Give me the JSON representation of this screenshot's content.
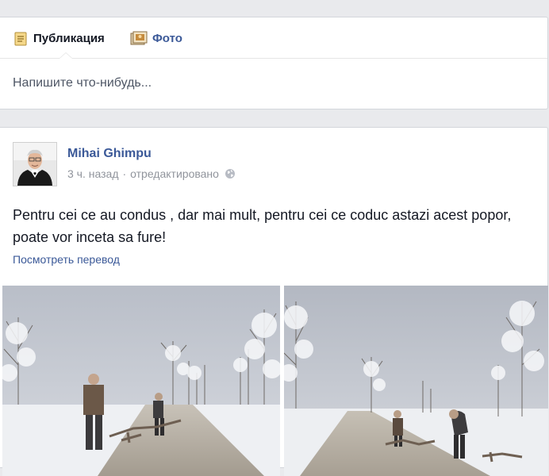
{
  "composer": {
    "tabs": [
      {
        "label": "Публикация",
        "icon": "status-icon"
      },
      {
        "label": "Фото",
        "icon": "photo-icon"
      }
    ],
    "placeholder": "Напишите что-нибудь..."
  },
  "post": {
    "author": "Mihai Ghimpu",
    "time": "3 ч. назад",
    "separator": "·",
    "edited": "отредактировано",
    "privacy_icon": "globe-icon",
    "text": "Pentru cei ce au condus , dar mai mult, pentru cei ce coduc astazi acest popor, poate vor inceta sa fure!",
    "see_translation": "Посмотреть перевод"
  },
  "colors": {
    "link": "#3b5998",
    "background": "#e9eaed",
    "text": "#141823",
    "meta": "#90949c"
  }
}
